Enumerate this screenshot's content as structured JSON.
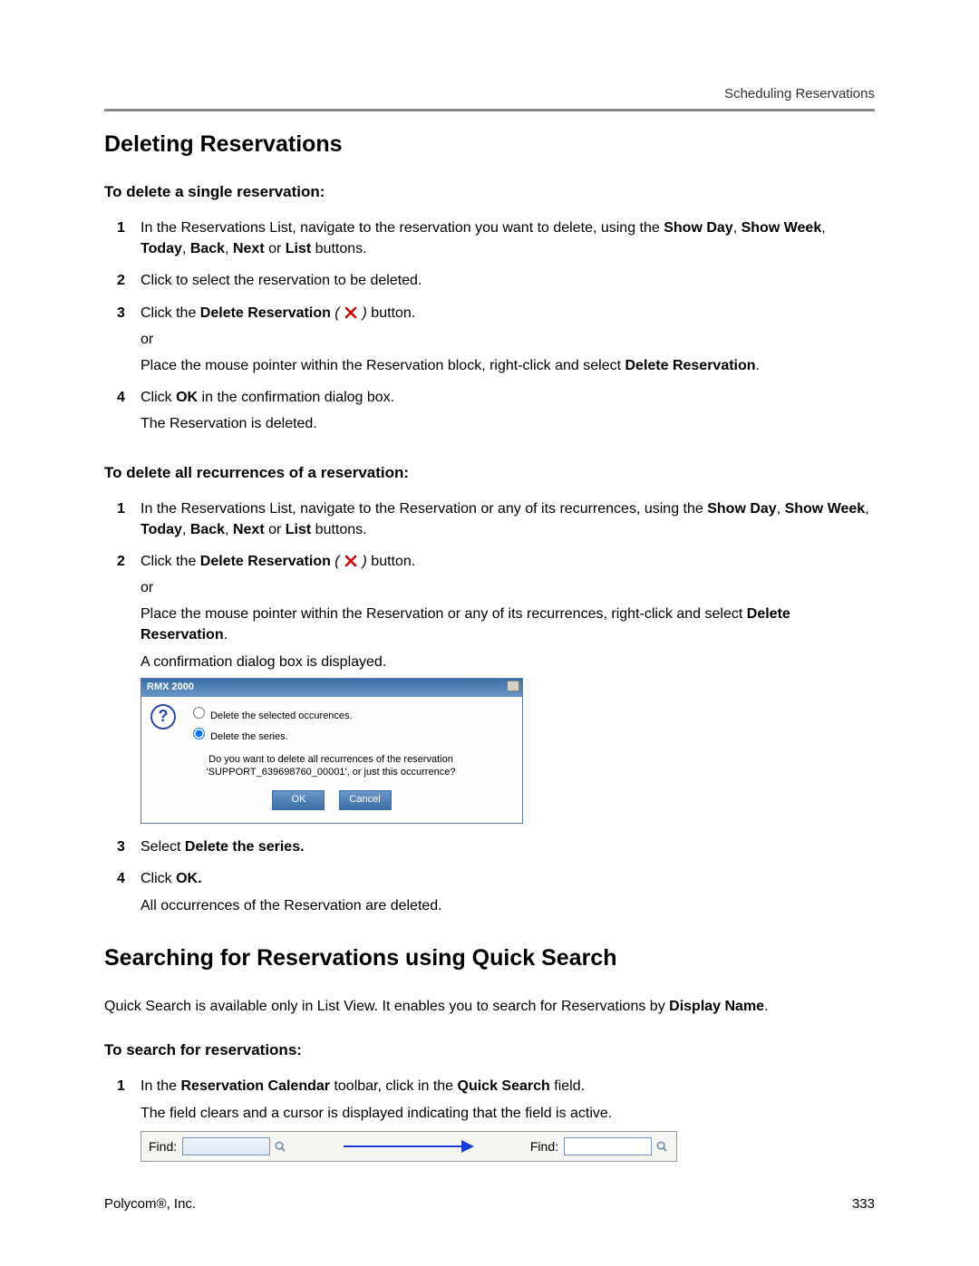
{
  "header": {
    "running_head": "Scheduling Reservations"
  },
  "section1": {
    "title": "Deleting Reservations",
    "sub1": {
      "title": "To delete a single reservation:",
      "steps": [
        {
          "n": "1",
          "pre": "In the Reservations List, navigate to the reservation you want to delete, using the ",
          "bold": "Show Day",
          "post": ", ",
          "bold2": "Show Week",
          "post2": ", ",
          "bold3": "Today",
          "post3": ", ",
          "bold4": "Back",
          "post4": ", ",
          "bold5": "Next",
          "post5": " or ",
          "bold6": "List",
          "post6": " buttons."
        },
        {
          "n": "2",
          "text": "Click to select the reservation to be deleted."
        },
        {
          "n": "3",
          "pre": "Click the ",
          "bold": "Delete Reservation",
          "italic_open": " ( ",
          "icon": "delete-reservation-icon",
          "italic_close": " ) ",
          "post": "button.",
          "or": "or",
          "tail": "Place the mouse pointer within the Reservation block, right-click and select ",
          "tail_bold": "Delete Reservation",
          "tail_post": "."
        },
        {
          "n": "4",
          "pre": "Click ",
          "bold": "OK",
          "post": " in the confirmation dialog box.",
          "tail": "The Reservation is deleted."
        }
      ]
    },
    "sub2": {
      "title": "To delete all recurrences of a reservation:",
      "steps": [
        {
          "n": "1",
          "pre": "In the Reservations List, navigate to the Reservation or any of its recurrences, using the ",
          "bold": "Show Day",
          "post": ", ",
          "bold2": "Show Week",
          "post2": ", ",
          "bold3": "Today",
          "post3": ", ",
          "bold4": "Back",
          "post4": ", ",
          "bold5": "Next",
          "post5": " or ",
          "bold6": "List",
          "post6": " buttons."
        },
        {
          "n": "2",
          "pre": "Click the ",
          "bold": "Delete Reservation",
          "italic_open": " ( ",
          "icon": "delete-reservation-icon",
          "italic_close": " ) ",
          "post": "button.",
          "or": "or",
          "tail": "Place the mouse pointer within the Reservation or any of its recurrences, right-click and select ",
          "tail_bold": "Delete Reservation",
          "tail_post": ".",
          "tail2": "A confirmation dialog box is displayed."
        },
        {
          "n": "3",
          "pre": "Select ",
          "bold": "Delete the series."
        },
        {
          "n": "4",
          "pre": "Click ",
          "bold": "OK.",
          "tail": "All occurrences of the Reservation are deleted."
        }
      ]
    }
  },
  "dialog": {
    "title": "RMX 2000",
    "opt1": "Delete the selected occurences.",
    "opt2": "Delete the series.",
    "msg": "Do you want to delete all recurrences of the reservation 'SUPPORT_639698760_00001', or just this occurrence?",
    "ok": "OK",
    "cancel": "Cancel"
  },
  "section2": {
    "title": "Searching for Reservations using Quick Search",
    "intro_pre": "Quick Search is available only in List View. It enables you to search for Reservations by ",
    "intro_bold": "Display Name",
    "intro_post": ".",
    "sub": {
      "title": "To search for reservations:",
      "steps": [
        {
          "n": "1",
          "pre": "In the ",
          "bold": "Reservation Calendar",
          "mid": " toolbar, click in the ",
          "bold2": "Quick Search",
          "post": " field.",
          "tail": "The field clears and a cursor is displayed indicating that the field is active."
        }
      ]
    }
  },
  "findbar": {
    "label": "Find:"
  },
  "footer": {
    "left": "Polycom®, Inc.",
    "right": "333"
  }
}
